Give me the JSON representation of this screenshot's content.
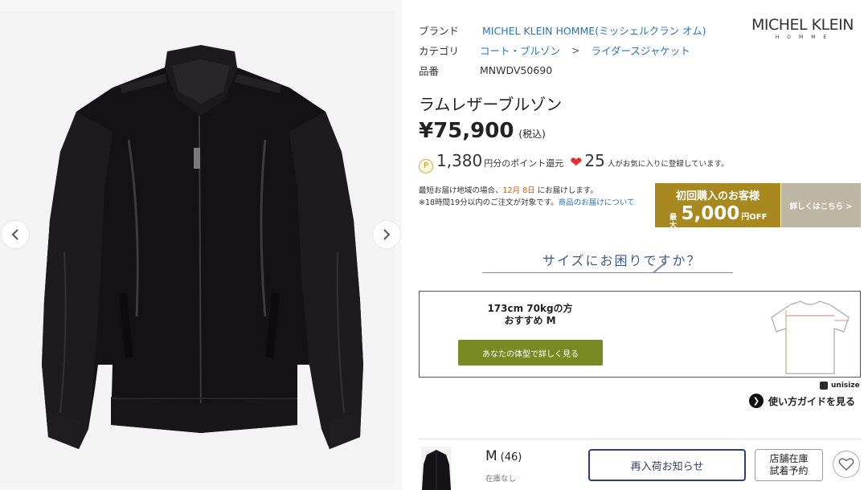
{
  "gallery": {
    "prev_label": "previous image",
    "next_label": "next image"
  },
  "brand_logo": {
    "main": "MICHEL KLEIN",
    "sub": "HOMME"
  },
  "specs": {
    "brand_label": "ブランド",
    "brand_value": "MICHEL KLEIN HOMME(ミッシェルクラン オム)",
    "category_label": "カテゴリ",
    "category_1": "コート・ブルゾン",
    "category_sep": ">",
    "category_2": "ライダースジャケット",
    "sku_label": "品番",
    "sku_value": "MNWDV50690"
  },
  "product": {
    "name": "ラムレザーブルゾン",
    "price": "¥75,900",
    "tax": "(税込)"
  },
  "points": {
    "icon_letter": "P",
    "amount": "1,380",
    "text": "円分のポイント還元",
    "favorites": "25",
    "favorites_text": "人がお気に入りに登録しています。"
  },
  "delivery": {
    "line1_prefix": "最短お届け地域の場合、",
    "date": "12月 8日",
    "line1_suffix": "にお届けします。",
    "line2_prefix": "※18時間19分以内のご注文が対象です。",
    "line2_link": "商品のお届けについて"
  },
  "promo": {
    "title": "初回購入のお客様",
    "max": "最大",
    "amount": "5,000",
    "off": "円OFF",
    "more": "詳しくはこちら >"
  },
  "size_help": {
    "title": "サイズにお困りですか？",
    "recommend_line1": "173cm 70kgの方",
    "recommend_line2": "おすすめ M",
    "button": "あなたの体型で詳しく見る",
    "unisize": "unisize",
    "guide": "使い方ガイドを見る"
  },
  "variant": {
    "size": "M",
    "size_num": "(46)",
    "stock": "在庫なし",
    "restock_button": "再入荷お知らせ",
    "store_button_line1": "店舗在庫",
    "store_button_line2": "試着予約"
  },
  "colors": {
    "link": "#2a73b8",
    "promo_gold": "#a8891f",
    "size_button": "#7a8a23",
    "restock_border": "#2e3f6e",
    "delivery_date": "#d05a14"
  }
}
